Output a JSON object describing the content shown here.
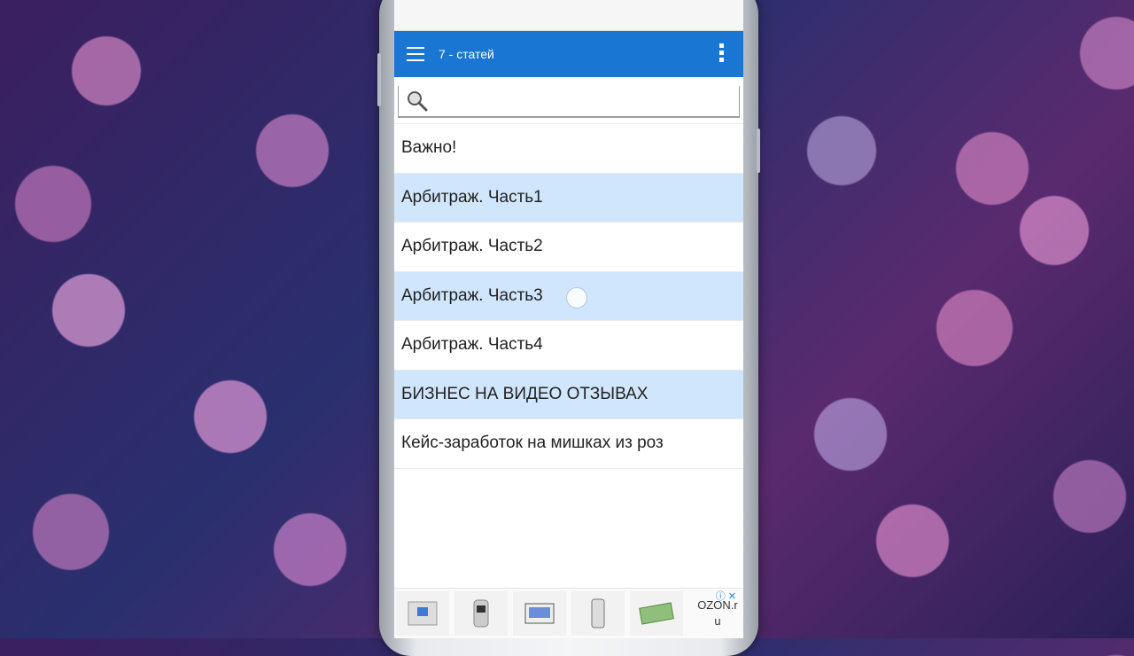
{
  "appbar": {
    "title": "7 - статей"
  },
  "search": {
    "placeholder": ""
  },
  "articles": [
    {
      "label": "Важно!"
    },
    {
      "label": "Арбитраж. Часть1"
    },
    {
      "label": "Арбитраж. Часть2"
    },
    {
      "label": "Арбитраж. Часть3"
    },
    {
      "label": "Арбитраж. Часть4"
    },
    {
      "label": "БИЗНЕС НА ВИДЕО ОТЗЫВАХ"
    },
    {
      "label": "Кейс-заработок на мишках из роз"
    }
  ],
  "ad": {
    "brand": "OZON.r\nu",
    "info": "ⓘ ✕"
  },
  "colors": {
    "appbar": "#1976d2",
    "row_highlight": "#cfe6fc"
  },
  "icons": [
    "hamburger-menu-icon",
    "more-vert-icon",
    "search-icon"
  ]
}
